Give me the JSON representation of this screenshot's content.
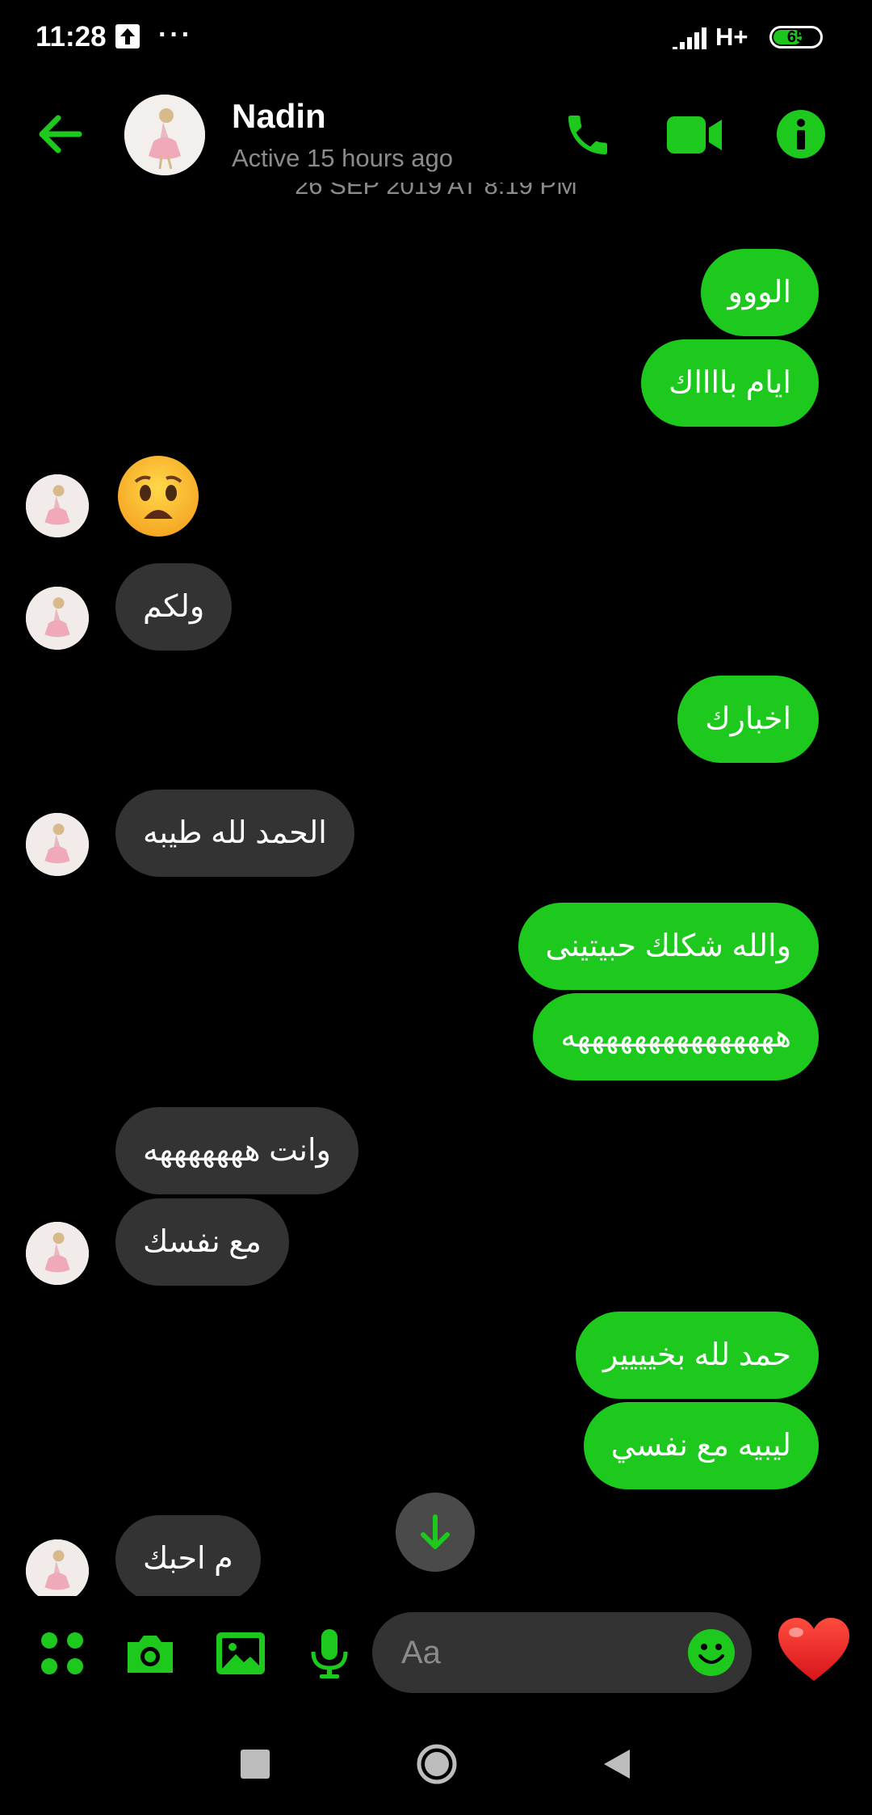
{
  "status_bar": {
    "time": "11:28",
    "more": "···",
    "network": "H+",
    "battery_percent": "65",
    "battery_level": 0.65
  },
  "header": {
    "contact_name": "Nadin",
    "status": "Active 15 hours ago"
  },
  "date_separator": "26 SEP 2019 AT 8:19 PM",
  "messages": [
    {
      "from": "me",
      "text": "الووو"
    },
    {
      "from": "me",
      "text": "ايام بااااك"
    },
    {
      "from": "them",
      "emoji": "worried-face"
    },
    {
      "from": "them",
      "text": "ولكم"
    },
    {
      "from": "me",
      "text": "اخبارك"
    },
    {
      "from": "them",
      "text": "الحمد لله طيبه"
    },
    {
      "from": "me",
      "text": "والله شكلك حبيتينى"
    },
    {
      "from": "me",
      "text": "هههههههههههههههه"
    },
    {
      "from": "them",
      "text": "وانت هههههههه"
    },
    {
      "from": "them",
      "text": "مع نفسك"
    },
    {
      "from": "me",
      "text": "حمد لله بخيييير"
    },
    {
      "from": "me",
      "text": "ليبيه مع نفسي"
    },
    {
      "from": "them",
      "text": "م احبك"
    }
  ],
  "composer": {
    "placeholder": "Aa"
  },
  "icons": [
    "back-arrow-icon",
    "phone-icon",
    "video-camera-icon",
    "info-icon",
    "scroll-down-arrow-icon",
    "apps-grid-icon",
    "camera-icon",
    "gallery-icon",
    "microphone-icon",
    "smiley-icon",
    "heart-icon"
  ],
  "colors": {
    "accent": "#1ec91e",
    "background": "#000000",
    "received_bubble": "#333333",
    "secondary_text": "#8b8b8b"
  }
}
